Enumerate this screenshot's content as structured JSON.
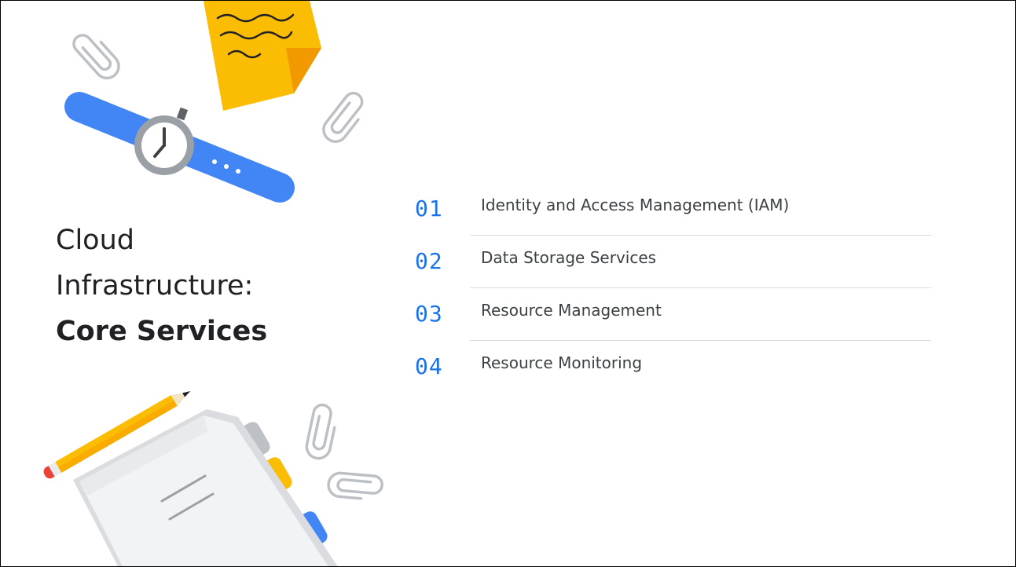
{
  "title": {
    "line1": "Cloud",
    "line2": "Infrastructure:",
    "line3": "Core Services"
  },
  "agenda": [
    {
      "number": "01",
      "label": "Identity and Access Management (IAM)"
    },
    {
      "number": "02",
      "label": "Data Storage Services"
    },
    {
      "number": "03",
      "label": "Resource Management"
    },
    {
      "number": "04",
      "label": "Resource Monitoring"
    }
  ],
  "colors": {
    "accent_blue": "#1a73e8",
    "watch_band_blue": "#4285f4",
    "sticky_yellow": "#fbbc04",
    "title_text": "#202124",
    "item_text": "#3c4043",
    "divider": "#dadce0"
  },
  "icons": [
    "sticky-note-icon",
    "wristwatch-icon",
    "paperclip-icon",
    "pencil-icon",
    "notebook-icon"
  ]
}
